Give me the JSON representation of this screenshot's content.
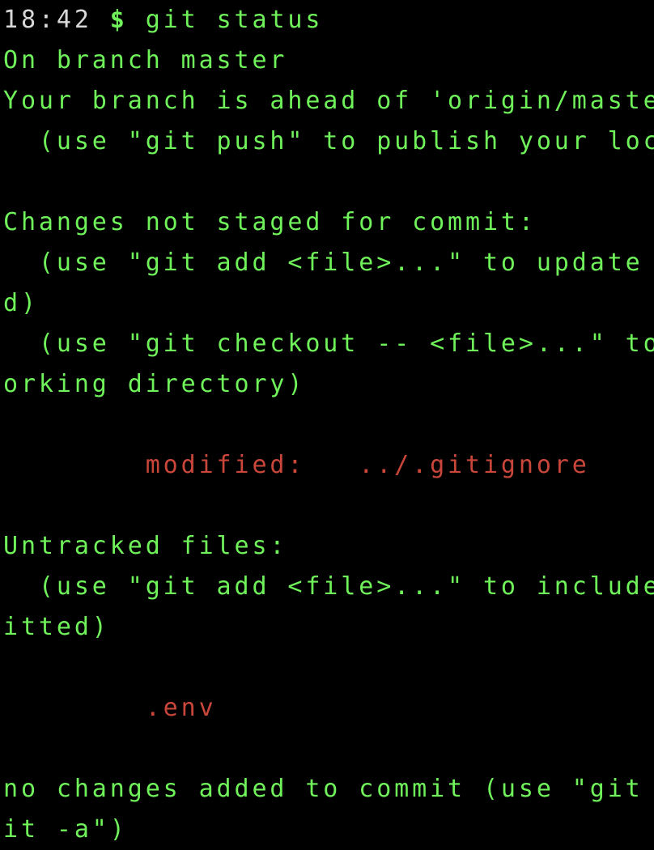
{
  "prompt": {
    "time": "18:42",
    "symbol": "$",
    "command": "git status"
  },
  "output": {
    "branch_line": "On branch master",
    "ahead_line": "Your branch is ahead of 'origin/maste",
    "push_hint": "  (use \"git push\" to publish your loc",
    "not_staged_header": "Changes not staged for commit:",
    "add_hint_1": "  (use \"git add <file>...\" to update ",
    "add_hint_1_wrap": "d)",
    "checkout_hint": "  (use \"git checkout -- <file>...\" to",
    "checkout_hint_wrap": "orking directory)",
    "modified_label": "        modified:   ",
    "modified_file": "../.gitignore",
    "untracked_header": "Untracked files:",
    "add_hint_2": "  (use \"git add <file>...\" to include",
    "add_hint_2_wrap": "itted)",
    "untracked_file": "        .env",
    "no_changes_line": "no changes added to commit (use \"git ",
    "no_changes_wrap": "it -a\")"
  },
  "colors": {
    "background": "#000000",
    "text": "#6ff25a",
    "time": "#d8d8d8",
    "changed": "#c9463a"
  }
}
